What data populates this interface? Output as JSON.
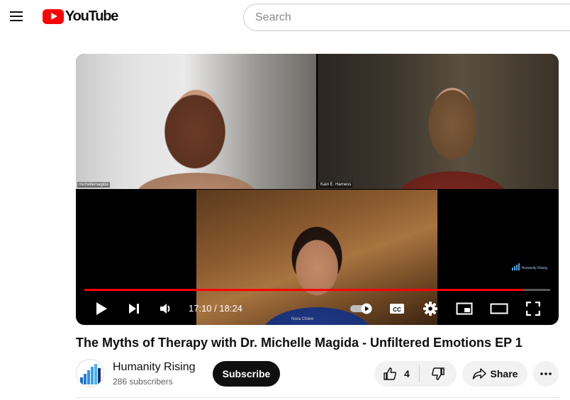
{
  "header": {
    "menu_icon": "hamburger-menu-icon",
    "logo_text": "YouTube",
    "brand_color": "#ff0000",
    "search": {
      "placeholder": "Search",
      "value": ""
    }
  },
  "player": {
    "participants": [
      {
        "name": "michellemagida"
      },
      {
        "name": "Kairi E. Harness"
      },
      {
        "name": "Nora Chiew"
      }
    ],
    "watermark": "Humanity Rising",
    "progress": 0.943,
    "progress_color": "#ff0000",
    "time_display": "17:10 / 18:24",
    "controls": [
      "play-icon",
      "next-icon",
      "volume-icon",
      "autoplay-toggle-icon",
      "captions-icon",
      "settings-gear-icon",
      "miniplayer-icon",
      "theater-mode-icon",
      "fullscreen-icon"
    ]
  },
  "video": {
    "title": "The Myths of Therapy with Dr. Michelle Magida - Unfiltered Emotions EP 1"
  },
  "channel": {
    "name": "Humanity Rising",
    "subscribers": "286 subscribers",
    "subscribe_label": "Subscribe"
  },
  "actions": {
    "like_count": "4",
    "share_label": "Share"
  }
}
